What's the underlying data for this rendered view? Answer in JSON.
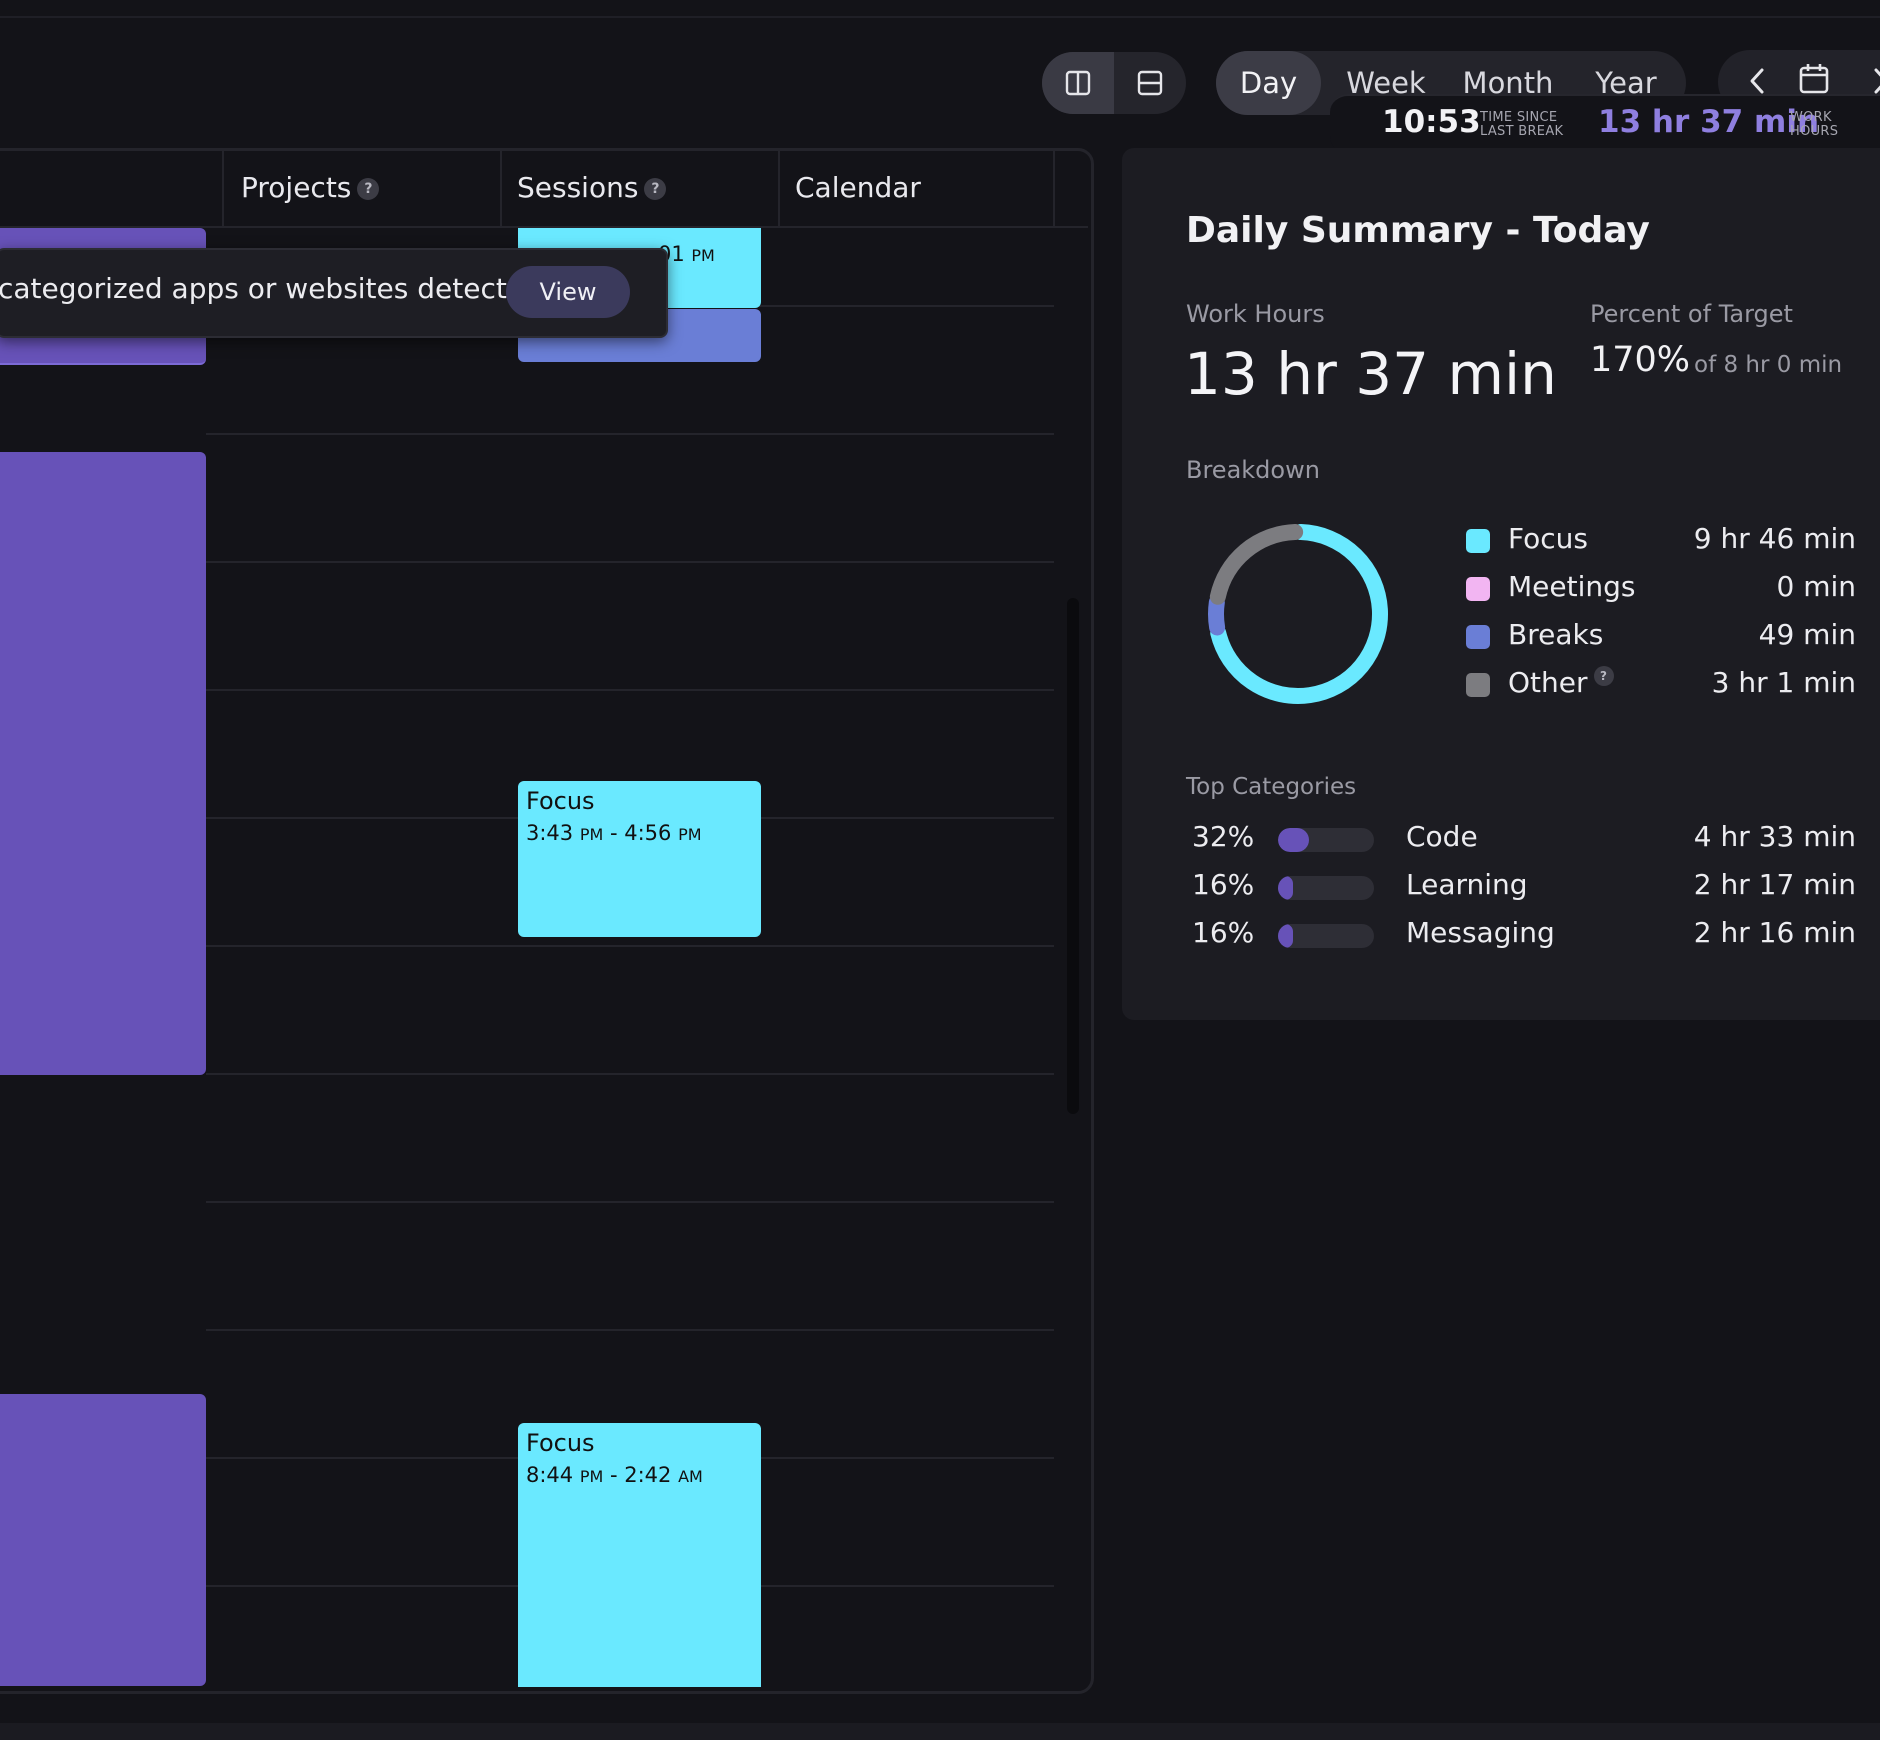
{
  "header": {
    "range_tabs": [
      "Day",
      "Week",
      "Month",
      "Year"
    ],
    "active_range": "Day",
    "time_since_last_break": {
      "value": "10:53",
      "label_line1": "TIME SINCE",
      "label_line2": "LAST BREAK"
    },
    "work_hours": {
      "value": "13 hr 37 min",
      "label_line1": "WORK",
      "label_line2": "HOURS"
    }
  },
  "timeline": {
    "columns": [
      {
        "label": "Projects",
        "help": "?"
      },
      {
        "label": "Sessions",
        "help": "?"
      },
      {
        "label": "Calendar"
      }
    ],
    "toast": {
      "text": "categorized apps or websites detected!",
      "button": "View"
    },
    "sessions": [
      {
        "title": "Focus",
        "start": "3:43",
        "start_ampm": "PM",
        "end": "4:56",
        "end_ampm": "PM"
      },
      {
        "title": "Focus",
        "start": "8:44",
        "start_ampm": "PM",
        "end": "2:42",
        "end_ampm": "AM"
      }
    ]
  },
  "summary": {
    "title": "Daily Summary - Today",
    "work_hours_label": "Work Hours",
    "work_hours_value": "13 hr 37 min",
    "percent_label": "Percent of Target",
    "percent_value": "170%",
    "percent_of": "of 8 hr 0 min",
    "breakdown_label": "Breakdown",
    "breakdown": [
      {
        "label": "Focus",
        "value": "9 hr 46 min",
        "minutes": 586,
        "color": "#6ae9ff"
      },
      {
        "label": "Meetings",
        "value": "0 min",
        "minutes": 0,
        "color": "#f2b5f2"
      },
      {
        "label": "Breaks",
        "value": "49 min",
        "minutes": 49,
        "color": "#6a7ed6"
      },
      {
        "label": "Other",
        "value": "3 hr 1 min",
        "minutes": 181,
        "color": "#7c7c80",
        "help": "?"
      }
    ],
    "top_categories_label": "Top Categories",
    "top_categories": [
      {
        "percent": "32%",
        "fraction": 0.32,
        "name": "Code",
        "value": "4 hr 33 min"
      },
      {
        "percent": "16%",
        "fraction": 0.16,
        "name": "Learning",
        "value": "2 hr 17 min"
      },
      {
        "percent": "16%",
        "fraction": 0.16,
        "name": "Messaging",
        "value": "2 hr 16 min"
      }
    ]
  },
  "colors": {
    "accent_purple": "#6752b8",
    "focus_cyan": "#6ae9ff",
    "work_hours_text": "#8f7fe0"
  }
}
